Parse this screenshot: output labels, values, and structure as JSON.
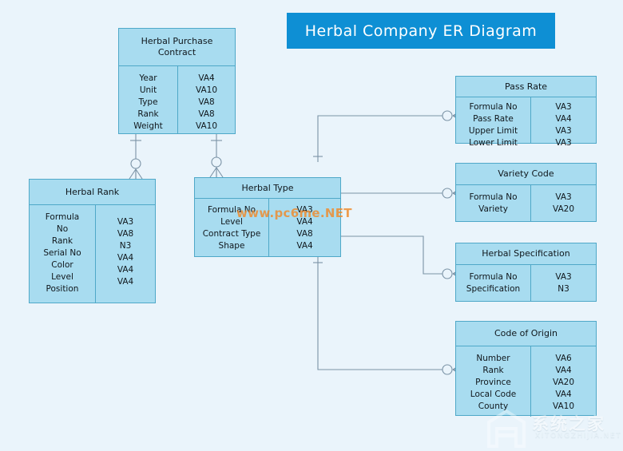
{
  "title": {
    "text": "Herbal Company ER Diagram",
    "banner_color": "#0e8fd4",
    "text_color": "#ffffff"
  },
  "theme": {
    "background": "#eaf4fb",
    "entity_fill": "#a8dcf0",
    "entity_border": "#4fa8c8",
    "connector_color": "#7b93a6",
    "text_color": "#10171c"
  },
  "entities": [
    {
      "id": "herbal-purchase-contract",
      "name": "Herbal Purchase\nContract",
      "fields": [
        "Year",
        "Unit",
        "Type",
        "Rank",
        "Weight"
      ],
      "types": [
        "VA4",
        "VA10",
        "VA8",
        "VA8",
        "VA10"
      ]
    },
    {
      "id": "herbal-rank",
      "name": "Herbal Rank",
      "fields": [
        "Formula\nNo",
        "Rank",
        "Serial No",
        "Color",
        "Level",
        "Position"
      ],
      "types": [
        "VA3",
        "VA8",
        "N3",
        "VA4",
        "VA4",
        "VA4"
      ]
    },
    {
      "id": "herbal-type",
      "name": "Herbal Type",
      "fields": [
        "Formula No",
        "Level",
        "Contract Type",
        "Shape"
      ],
      "types": [
        "VA3",
        "VA4",
        "VA8",
        "VA4"
      ]
    },
    {
      "id": "pass-rate",
      "name": "Pass Rate",
      "fields": [
        "Formula No",
        "Pass Rate",
        "Upper Limit",
        "Lower Limit"
      ],
      "types": [
        "VA3",
        "VA4",
        "VA3",
        "VA3"
      ]
    },
    {
      "id": "variety-code",
      "name": "Variety Code",
      "fields": [
        "Formula No",
        "Variety"
      ],
      "types": [
        "VA3",
        "VA20"
      ]
    },
    {
      "id": "herbal-specification",
      "name": "Herbal Specification",
      "fields": [
        "Formula No",
        "Specification"
      ],
      "types": [
        "VA3",
        "N3"
      ]
    },
    {
      "id": "code-of-origin",
      "name": "Code of Origin",
      "fields": [
        "Number",
        "Rank",
        "Province",
        "Local Code",
        "County"
      ],
      "types": [
        "VA6",
        "VA4",
        "VA20",
        "VA4",
        "VA10"
      ]
    }
  ],
  "relationships": [
    {
      "from": "herbal-purchase-contract",
      "to": "herbal-rank",
      "from_card": "one",
      "to_card": "zero-or-many"
    },
    {
      "from": "herbal-purchase-contract",
      "to": "herbal-type",
      "from_card": "one",
      "to_card": "zero-or-many"
    },
    {
      "from": "herbal-type",
      "to": "pass-rate",
      "from_card": "one",
      "to_card": "zero-or-many"
    },
    {
      "from": "herbal-type",
      "to": "variety-code",
      "from_card": "one",
      "to_card": "zero-or-many"
    },
    {
      "from": "herbal-type",
      "to": "herbal-specification",
      "from_card": "one",
      "to_card": "zero-or-many"
    },
    {
      "from": "herbal-type",
      "to": "code-of-origin",
      "from_card": "one",
      "to_card": "zero-or-many"
    }
  ],
  "watermarks": {
    "center": "www.pc6me.NET",
    "corner_cn": "系统之家",
    "corner_en": "XITONGZHIJIA.NET"
  }
}
